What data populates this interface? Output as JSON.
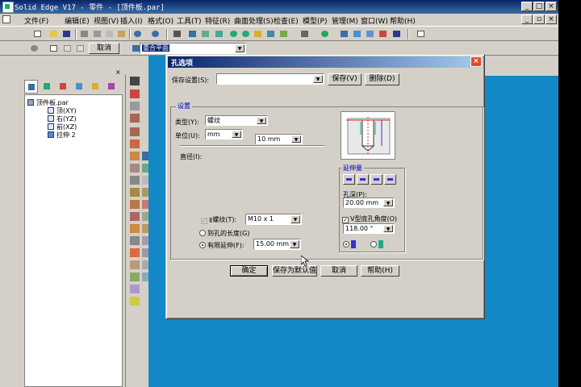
{
  "window": {
    "title": "Solid Edge V17 - 零件 - [顶件板.par]"
  },
  "menu": [
    "文件(F)",
    "编辑(E)",
    "视图(V)",
    "插入(I)",
    "格式(O)",
    "工具(T)",
    "特征(R)",
    "曲面处理(S)",
    "检查(E)",
    "模型(P)",
    "管理(M)",
    "窗口(W)",
    "帮助(H)"
  ],
  "toolbar2": {
    "cancel_label": "取消",
    "plane_select": "重合平面"
  },
  "tree": {
    "root": "顶件板.par",
    "items": [
      "顶(XY)",
      "右(YZ)",
      "前(XZ)",
      "拉伸 2"
    ]
  },
  "dialog": {
    "title": "孔选项",
    "save_settings_label": "保存设置(S):",
    "save_settings_value": "",
    "save_button": "保存(V)",
    "delete_button": "删除(D)",
    "settings_group": "设置",
    "type_label": "类型(Y):",
    "type_value": "螺纹",
    "unit_label": "单位(U):",
    "unit_value": "mm",
    "size_value": "10 mm",
    "diameter_label": "直径(I):",
    "thread_label": "螺纹(T):",
    "thread_value": "M10 x 1",
    "to_hole_depth_label": "到孔的长度(G)",
    "finite_extent_label": "有限延伸(F):",
    "finite_extent_value": "15.00 mm",
    "extent_group": "延伸量",
    "hole_depth_label": "孔深(P):",
    "hole_depth_value": "20.00 mm",
    "v_bottom_label": "V型底孔角度(O)",
    "v_bottom_value": "118.00 °",
    "ok_button": "确定",
    "save_default_button": "保存为默认值",
    "cancel_button": "取消",
    "help_button": "帮助(H)"
  },
  "colors": {
    "titlebar": "#0a246a",
    "viewport": "#1388c7",
    "dialog_close": "#e04a2a",
    "group_title": "#0000c0"
  }
}
